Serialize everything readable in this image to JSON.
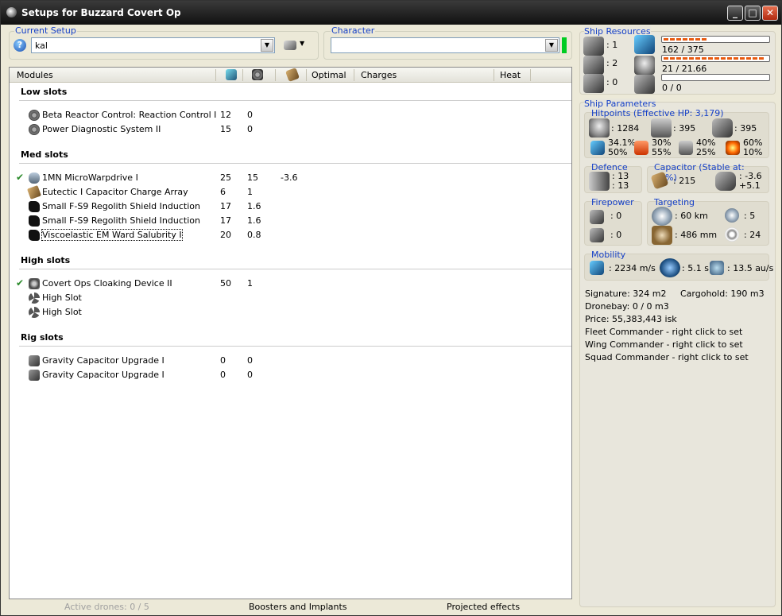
{
  "window": {
    "title": "Setups for Buzzard Covert Op",
    "min": "_",
    "max": "□",
    "close": "✕"
  },
  "setup": {
    "label": "Current Setup",
    "value": "kal"
  },
  "character": {
    "label": "Character",
    "value": ""
  },
  "modules_header": {
    "modules": "Modules",
    "optimal": "Optimal",
    "charges": "Charges",
    "heat": "Heat"
  },
  "sections": {
    "low": {
      "title": "Low slots",
      "rows": [
        {
          "name": "Beta Reactor Control: Reaction Control I",
          "cpu": "12",
          "pg": "0",
          "cap": ""
        },
        {
          "name": "Power Diagnostic System II",
          "cpu": "15",
          "pg": "0",
          "cap": ""
        }
      ]
    },
    "med": {
      "title": "Med slots",
      "rows": [
        {
          "name": "1MN MicroWarpdrive I",
          "cpu": "25",
          "pg": "15",
          "cap": "-3.6"
        },
        {
          "name": "Eutectic I Capacitor Charge Array",
          "cpu": "6",
          "pg": "1",
          "cap": ""
        },
        {
          "name": "Small F-S9 Regolith Shield Induction",
          "cpu": "17",
          "pg": "1.6",
          "cap": ""
        },
        {
          "name": "Small F-S9 Regolith Shield Induction",
          "cpu": "17",
          "pg": "1.6",
          "cap": ""
        },
        {
          "name": "Viscoelastic EM Ward Salubrity I",
          "cpu": "20",
          "pg": "0.8",
          "cap": ""
        }
      ]
    },
    "high": {
      "title": "High slots",
      "rows": [
        {
          "name": "Covert Ops Cloaking Device II",
          "cpu": "50",
          "pg": "1",
          "cap": ""
        },
        {
          "name": "High Slot",
          "cpu": "",
          "pg": "",
          "cap": ""
        },
        {
          "name": "High Slot",
          "cpu": "",
          "pg": "",
          "cap": ""
        }
      ]
    },
    "rig": {
      "title": "Rig slots",
      "rows": [
        {
          "name": "Gravity Capacitor Upgrade I",
          "cpu": "0",
          "pg": "0",
          "cap": ""
        },
        {
          "name": "Gravity Capacitor Upgrade I",
          "cpu": "0",
          "pg": "0",
          "cap": ""
        }
      ]
    }
  },
  "statusbar": {
    "drones": "Active drones: 0 / 5",
    "boosters": "Boosters and Implants",
    "projected": "Projected effects"
  },
  "resources": {
    "title": "Ship Resources",
    "turrets": ": 1",
    "launchers": ": 2",
    "drones": ": 0",
    "cpu_text": "162 / 375",
    "cpu_fraction": 0.43,
    "pg_text": "21 / 21.66",
    "pg_fraction": 0.97,
    "bay_text": "0 / 0",
    "bay_fraction": 0
  },
  "params": {
    "title": "Ship Parameters",
    "hp_title": "Hitpoints (Effective HP: 3,179)",
    "shield_hp": ": 1284",
    "armor_hp": ": 395",
    "hull_hp": ": 395",
    "em": [
      "34.1%",
      "50%"
    ],
    "thermal": [
      "30%",
      "55%"
    ],
    "kinetic": [
      "40%",
      "25%"
    ],
    "explosive": [
      "60%",
      "10%"
    ],
    "defence_title": "Defence",
    "def1": ": 13",
    "def2": ": 13",
    "cap_title": "Capacitor (Stable at: 62%)",
    "cap_amount": ": 215",
    "cap_use": ": -3.6",
    "cap_recharge": "+5.1",
    "firepower_title": "Firepower",
    "fp1": ": 0",
    "fp2": ": 0",
    "targeting_title": "Targeting",
    "range": ": 60 km",
    "targets": ": 5",
    "scan": ": 486 mm",
    "sig_res": ": 24",
    "mobility_title": "Mobility",
    "speed": ": 2234 m/s",
    "align": ": 5.1 s",
    "warp": ": 13.5 au/s"
  },
  "info": {
    "signature": "Signature: 324 m2",
    "cargohold": "Cargohold: 190 m3",
    "dronebay": "Dronebay: 0 / 0 m3",
    "price": "Price: 55,383,443 isk",
    "fleet": "Fleet Commander - right click to set",
    "wing": "Wing Commander - right click to set",
    "squad": "Squad Commander - right click to set"
  }
}
